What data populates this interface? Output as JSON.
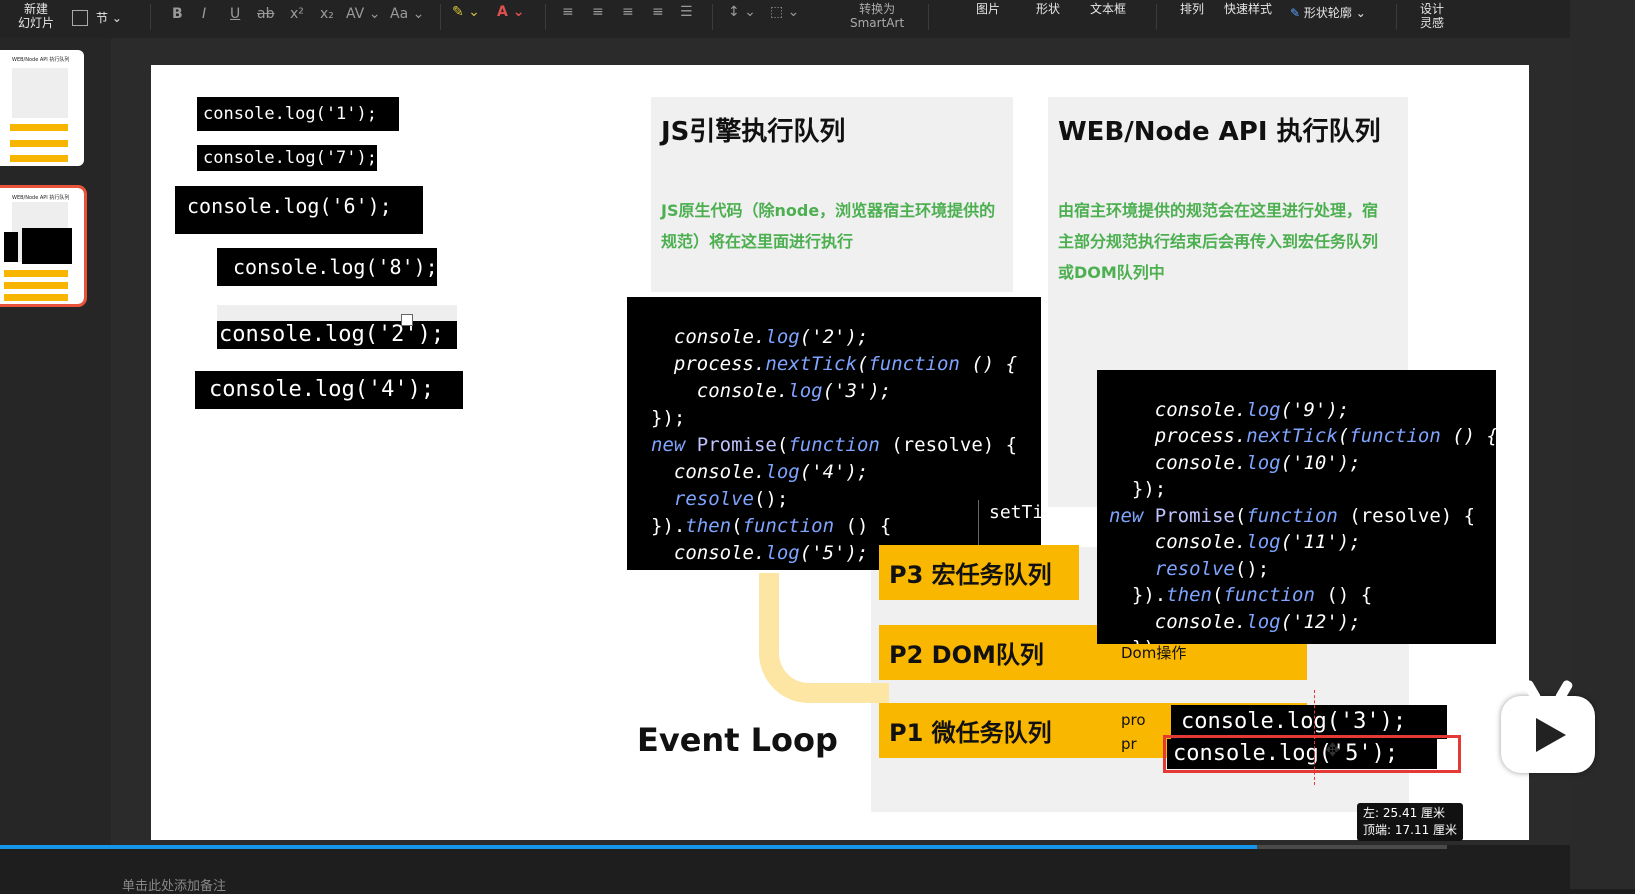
{
  "toolbar": {
    "new_slide": "新建\n幻灯片",
    "section": "节",
    "bold": "B",
    "italic": "I",
    "underline": "U",
    "strike": "ab",
    "superscript": "x²",
    "subscript": "x₂",
    "spacing": "AV",
    "case": "Aa",
    "smartart": "转换为\nSmartArt",
    "picture": "图片",
    "shape": "形状",
    "textbox": "文本框",
    "arrange": "排列",
    "quick_styles": "快速样式",
    "shape_outline": "形状轮廓",
    "design": "设计\n灵感"
  },
  "thumbnails": {
    "slide1_title": "WEB/Node API 执行队列",
    "slide2_title": "WEB/Node API 执行队列"
  },
  "slide": {
    "left_codes": [
      "console.log('1');",
      "console.log('7');",
      "console.log('6');",
      "console.log('8');",
      "console.log('2');",
      "console.log('4');"
    ],
    "js_panel": {
      "title": "JS引擎执行队列",
      "desc": "JS原生代码（除node，浏览器宿主环境提供的规范）将在这里面进行执行"
    },
    "web_panel": {
      "title": "WEB/Node API 执行队列",
      "desc": "由宿主环境提供的规范会在这里进行处理，宿主部分规范执行结束后会再传入到宏任务队列或DOM队列中"
    },
    "code_center": [
      "  console.log('2');",
      "  process.nextTick(function () {",
      "    console.log('3');",
      "});",
      "new Promise(function (resolve) {",
      "  console.log('4');",
      "  resolve();",
      "}).then(function () {",
      "  console.log('5');",
      "});"
    ],
    "settimeout_fragment": "setTi",
    "code_right": [
      "  console.log('9');",
      "  process.nextTick(function () {",
      "  console.log('10');",
      "  });",
      "new Promise(function (resolve) {",
      "  console.log('11');",
      "  resolve();",
      "  }).then(function () {",
      "  console.log('12');",
      "  });"
    ],
    "queues": {
      "p3": "P3 宏任务队列",
      "p2": "P2 DOM队列",
      "p2_note": "Dom操作",
      "p1": "P1 微任务队列",
      "p1_prefix_a": "pro",
      "p1_prefix_b": "pr"
    },
    "event_loop": "Event Loop",
    "micro_codes": [
      "console.log('3');",
      "console.log('5');"
    ],
    "tooltip": [
      "左: 25.41 厘米",
      "顶端: 17.11 厘米"
    ]
  },
  "notes_placeholder": "单击此处添加备注",
  "colors": {
    "accent": "#f9b700",
    "green": "#4caf50",
    "selection": "#e53935",
    "progress": "#1596e8"
  }
}
